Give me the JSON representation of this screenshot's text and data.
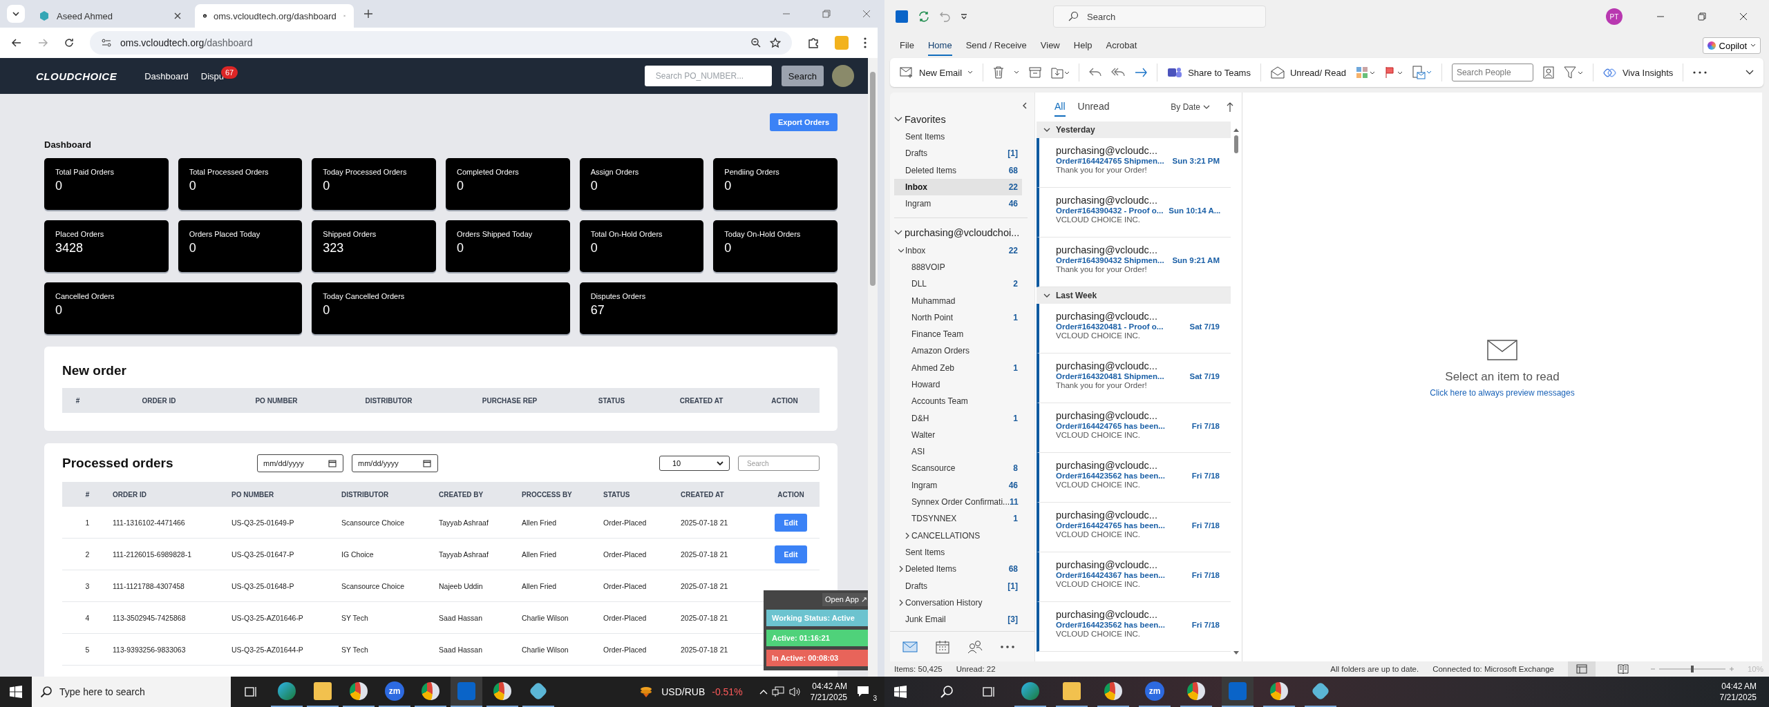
{
  "browser": {
    "tabs": [
      {
        "label": "Aseed Ahmed",
        "selected": false
      },
      {
        "label": "oms.vcloudtech.org/dashboard",
        "selected": true
      }
    ],
    "address": {
      "host": "oms.vcloudtech.org",
      "path": "/dashboard"
    }
  },
  "site": {
    "logo": "CLOUDCHOICE",
    "nav": [
      {
        "label": "Dashboard"
      },
      {
        "label": "Dispu",
        "badge": "67"
      }
    ],
    "search": {
      "placeholder": "Search PO_NUMBER..."
    },
    "search_button": "Search",
    "export_button": "Export Orders",
    "title": "Dashboard",
    "stat_rows": [
      [
        {
          "label": "Total Paid Orders",
          "value": "0"
        },
        {
          "label": "Total Processed Orders",
          "value": "0"
        },
        {
          "label": "Today Processed Orders",
          "value": "0"
        },
        {
          "label": "Completed Orders",
          "value": "0"
        },
        {
          "label": "Assign Orders",
          "value": "0"
        },
        {
          "label": "Pendiing Orders",
          "value": "0"
        }
      ],
      [
        {
          "label": "Placed Orders",
          "value": "3428"
        },
        {
          "label": "Orders Placed Today",
          "value": "0"
        },
        {
          "label": "Shipped Orders",
          "value": "323"
        },
        {
          "label": "Orders Shipped Today",
          "value": "0"
        },
        {
          "label": "Total On-Hold Orders",
          "value": "0"
        },
        {
          "label": "Today On-Hold Orders",
          "value": "0"
        }
      ],
      [
        {
          "label": "Cancelled Orders",
          "value": "0"
        },
        {
          "label": "Today Cancelled Orders",
          "value": "0"
        },
        {
          "label": "Disputes Orders",
          "value": "67"
        }
      ]
    ],
    "new_order": {
      "title": "New order",
      "columns": [
        "#",
        "ORDER ID",
        "PO NUMBER",
        "DISTRIBUTOR",
        "PURCHASE REP",
        "STATUS",
        "CREATED AT",
        "ACTION"
      ]
    },
    "processed": {
      "title": "Processed orders",
      "date_filters": [
        {
          "placeholder": "mm/dd/yyyy"
        },
        {
          "placeholder": "mm/dd/yyyy"
        }
      ],
      "page_size": "10",
      "search": {
        "placeholder": "Search"
      },
      "columns": [
        "#",
        "ORDER ID",
        "PO NUMBER",
        "DISTRIBUTOR",
        "CREATED BY",
        "PROCCESS BY",
        "STATUS",
        "CREATED AT",
        "ACTION"
      ],
      "rows": [
        {
          "cells": [
            "1",
            "111-1316102-4471466",
            "US-Q3-25-01649-P",
            "Scansource Choice",
            "Tayyab Ashraaf",
            "Allen Fried",
            "Order-Placed",
            "2025-07-18 21"
          ],
          "action": "Edit"
        },
        {
          "cells": [
            "2",
            "111-2126015-6989828-1",
            "US-Q3-25-01647-P",
            "IG Choice",
            "Tayyab Ashraaf",
            "Allen Fried",
            "Order-Placed",
            "2025-07-18 21"
          ],
          "action": "Edit"
        },
        {
          "cells": [
            "3",
            "111-1121788-4307458",
            "US-Q3-25-01648-P",
            "Scansource Choice",
            "Najeeb Uddin",
            "Allen Fried",
            "Order-Placed",
            "2025-07-18 21"
          ]
        },
        {
          "cells": [
            "4",
            "113-3502945-7425868",
            "US-Q3-25-AZ01646-P",
            "SY Tech",
            "Saad Hassan",
            "Charlie Wilson",
            "Order-Placed",
            "2025-07-18 21"
          ]
        },
        {
          "cells": [
            "5",
            "113-9393256-9833063",
            "US-Q3-25-AZ01644-P",
            "SY Tech",
            "Saad Hassan",
            "Charlie Wilson",
            "Order-Placed",
            "2025-07-18 21"
          ]
        }
      ]
    }
  },
  "tracker": {
    "open_app": "Open App ↗",
    "lines": [
      {
        "text": "Working Status: Active",
        "color": "#6cc3cf"
      },
      {
        "text": "Active: 01:16:21",
        "color": "#4fd27a"
      },
      {
        "text": "In Active: 00:08:03",
        "color": "#e8645a"
      }
    ]
  },
  "taskbar_left": {
    "search": {
      "placeholder": "Type here to search"
    },
    "apps": [
      {
        "kind": "edge",
        "active": false
      },
      {
        "kind": "files",
        "active": false
      },
      {
        "kind": "chrome",
        "active": false
      },
      {
        "kind": "zoom",
        "label": "zm",
        "active": false
      },
      {
        "kind": "chrome",
        "active": false
      },
      {
        "kind": "outlook",
        "active": true
      },
      {
        "kind": "chrome",
        "active": false
      },
      {
        "kind": "app",
        "active": false
      }
    ],
    "ticker": {
      "symbol": "USD/RUB",
      "change": "-0.51%"
    },
    "time": "04:42 AM",
    "date": "7/21/2025",
    "notifications": "3"
  },
  "outlook": {
    "search": {
      "placeholder": "Search"
    },
    "avatar": "PT",
    "menu": [
      {
        "label": "File",
        "selected": false
      },
      {
        "label": "Home",
        "selected": true
      },
      {
        "label": "Send / Receive",
        "selected": false
      },
      {
        "label": "View",
        "selected": false
      },
      {
        "label": "Help",
        "selected": false
      },
      {
        "label": "Acrobat",
        "selected": false
      }
    ],
    "copilot": "Copilot",
    "ribbon": {
      "new_email": "New Email",
      "share": "Share to Teams",
      "unread": "Unread/ Read",
      "search_people": {
        "placeholder": "Search People"
      },
      "viva": "Viva Insights"
    },
    "favorites": {
      "title": "Favorites",
      "expanded": true,
      "items": [
        {
          "name": "Sent Items",
          "selected": false
        },
        {
          "name": "Drafts",
          "count": "[1]",
          "selected": false
        },
        {
          "name": "Deleted Items",
          "count": "68",
          "selected": false
        },
        {
          "name": "Inbox",
          "count": "22",
          "selected": true
        },
        {
          "name": "Ingram",
          "count": "46",
          "selected": false
        }
      ]
    },
    "account": {
      "name": "purchasing@vcloudchoi...",
      "expanded": true,
      "folders": [
        {
          "name": "Inbox",
          "count": "22",
          "expanded": true,
          "children": [
            {
              "name": "888VOIP"
            },
            {
              "name": "DLL",
              "count": "2"
            },
            {
              "name": "Muhammad"
            },
            {
              "name": "North Point",
              "count": "1"
            },
            {
              "name": "Finance Team"
            },
            {
              "name": "Amazon Orders"
            },
            {
              "name": "Ahmed Zeb",
              "count": "1"
            },
            {
              "name": "Howard"
            },
            {
              "name": "Accounts Team"
            },
            {
              "name": "D&H",
              "count": "1"
            },
            {
              "name": "Walter"
            },
            {
              "name": "ASI"
            },
            {
              "name": "Scansource",
              "count": "8"
            },
            {
              "name": "Ingram",
              "count": "46"
            },
            {
              "name": "Synnex Order Confirmati...",
              "count": "11"
            },
            {
              "name": "TDSYNNEX",
              "count": "1"
            },
            {
              "name": "CANCELLATIONS",
              "expanded": false
            }
          ]
        },
        {
          "name": "Sent Items"
        },
        {
          "name": "Deleted Items",
          "count": "68",
          "expanded": false
        },
        {
          "name": "Drafts",
          "count": "[1]"
        },
        {
          "name": "Conversation History",
          "expanded": false
        },
        {
          "name": "Junk Email",
          "count": "[3]"
        }
      ]
    },
    "filters": [
      {
        "label": "All",
        "selected": true
      },
      {
        "label": "Unread",
        "selected": false
      }
    ],
    "sort": "By Date",
    "groups": [
      {
        "label": "Yesterday",
        "expanded": true,
        "messages": [
          {
            "sender": "purchasing@vcloudc...",
            "subject": "Order#164424765 Shipmen...",
            "date": "Sun 3:21 PM",
            "preview": "Thank you for your Order!",
            "unread": true
          },
          {
            "sender": "purchasing@vcloudc...",
            "subject": "Order#164390432 - Proof o...",
            "date": "Sun 10:14 A...",
            "preview": "VCLOUD CHOICE INC.",
            "unread": true
          },
          {
            "sender": "purchasing@vcloudc...",
            "subject": "Order#164390432 Shipmen...",
            "date": "Sun 9:21 AM",
            "preview": "Thank you for your Order!",
            "unread": true
          }
        ]
      },
      {
        "label": "Last Week",
        "expanded": true,
        "messages": [
          {
            "sender": "purchasing@vcloudc...",
            "subject": "Order#164320481 - Proof o...",
            "date": "Sat 7/19",
            "preview": "VCLOUD CHOICE INC.",
            "unread": true
          },
          {
            "sender": "purchasing@vcloudc...",
            "subject": "Order#164320481 Shipmen...",
            "date": "Sat 7/19",
            "preview": "Thank you for your Order!",
            "unread": true
          },
          {
            "sender": "purchasing@vcloudc...",
            "subject": "Order#164424765 has been...",
            "date": "Fri 7/18",
            "preview": "VCLOUD CHOICE INC.",
            "unread": true
          },
          {
            "sender": "purchasing@vcloudc...",
            "subject": "Order#164423562 has been...",
            "date": "Fri 7/18",
            "preview": "VCLOUD CHOICE INC.",
            "unread": true
          },
          {
            "sender": "purchasing@vcloudc...",
            "subject": "Order#164424765 has been...",
            "date": "Fri 7/18",
            "preview": "VCLOUD CHOICE INC.",
            "unread": true
          },
          {
            "sender": "purchasing@vcloudc...",
            "subject": "Order#164424367 has been...",
            "date": "Fri 7/18",
            "preview": "VCLOUD CHOICE INC.",
            "unread": true
          },
          {
            "sender": "purchasing@vcloudc...",
            "subject": "Order#164423562 has been...",
            "date": "Fri 7/18",
            "preview": "VCLOUD CHOICE INC.",
            "unread": true
          }
        ]
      }
    ],
    "reading": {
      "title": "Select an item to read",
      "link": "Click here to always preview messages"
    },
    "status": {
      "items": "Items: 50,425",
      "unread": "Unread: 22",
      "sync": "All folders are up to date.",
      "connection": "Connected to: Microsoft Exchange",
      "zoom_slider": {
        "level": 0.5
      },
      "zoom": "10%"
    }
  },
  "taskbar_right": {
    "apps": [
      {
        "kind": "edge",
        "active": false
      },
      {
        "kind": "files",
        "active": false
      },
      {
        "kind": "chrome",
        "active": false
      },
      {
        "kind": "zoom",
        "label": "zm",
        "active": false
      },
      {
        "kind": "chrome",
        "active": false
      },
      {
        "kind": "outlook",
        "active": true
      },
      {
        "kind": "chrome",
        "active": false
      },
      {
        "kind": "app",
        "active": false
      }
    ],
    "time": "04:42 AM",
    "date": "7/21/2025"
  }
}
